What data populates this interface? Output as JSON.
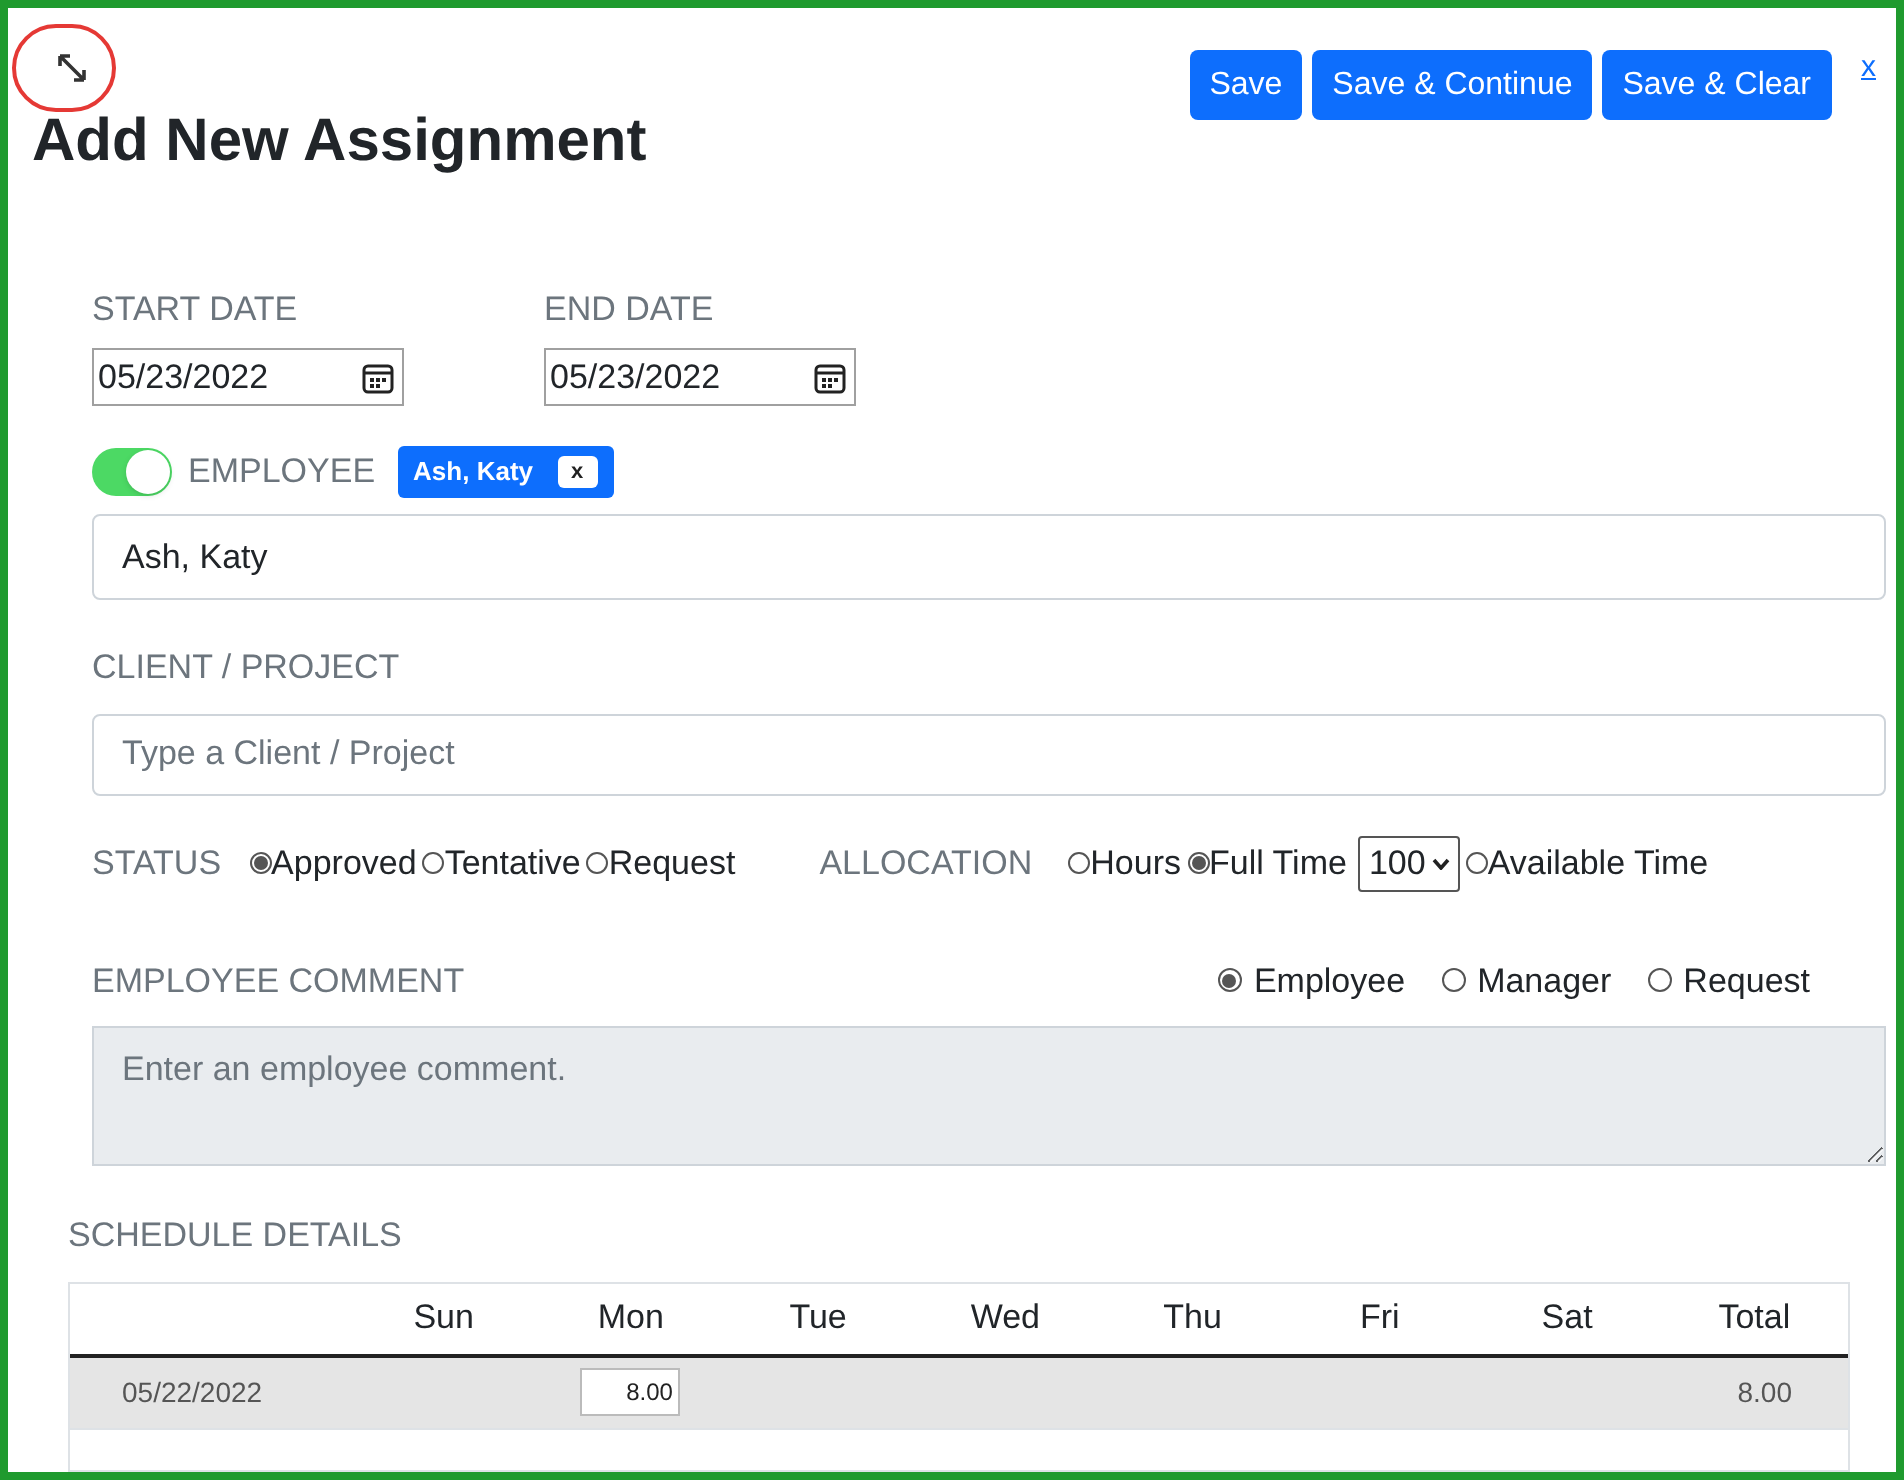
{
  "title": "Add New Assignment",
  "buttons": [
    {
      "label": "Save"
    },
    {
      "label": "Save & Continue"
    },
    {
      "label": "Save & Clear"
    }
  ],
  "close_link": "x",
  "start_date": {
    "label": "START DATE",
    "value": "05/23/2022"
  },
  "end_date": {
    "label": "END DATE",
    "value": "05/23/2022"
  },
  "employee": {
    "label": "EMPLOYEE",
    "on": true,
    "tag": "Ash, Katy",
    "tag_remove": "x",
    "value": "Ash, Katy"
  },
  "client_project": {
    "label": "CLIENT / PROJECT",
    "placeholder": "Type a Client / Project"
  },
  "status": {
    "label": "STATUS",
    "options": [
      {
        "label": "Approved",
        "selected": true
      },
      {
        "label": "Tentative",
        "selected": false
      },
      {
        "label": "Request",
        "selected": false
      }
    ]
  },
  "allocation": {
    "label": "ALLOCATION",
    "options": [
      {
        "kind": "radio",
        "label": "Hours",
        "selected": false
      },
      {
        "kind": "radio",
        "label": "Full Time",
        "selected": true
      },
      {
        "kind": "select",
        "value": "100"
      },
      {
        "kind": "radio",
        "label": "Available Time",
        "selected": false
      }
    ]
  },
  "comment": {
    "label": "EMPLOYEE COMMENT",
    "options": [
      {
        "label": "Employee",
        "selected": true
      },
      {
        "label": "Manager",
        "selected": false
      },
      {
        "label": "Request",
        "selected": false
      }
    ],
    "placeholder": "Enter an employee comment."
  },
  "schedule": {
    "label": "SCHEDULE DETAILS",
    "columns": [
      "Sun",
      "Mon",
      "Tue",
      "Wed",
      "Thu",
      "Fri",
      "Sat",
      "Total"
    ],
    "rows": [
      {
        "date": "05/22/2022",
        "cells": [
          {
            "kind": "empty"
          },
          {
            "kind": "input",
            "value": "8.00"
          },
          {
            "kind": "empty"
          },
          {
            "kind": "empty"
          },
          {
            "kind": "empty"
          },
          {
            "kind": "empty"
          },
          {
            "kind": "empty"
          }
        ],
        "total": "8.00"
      }
    ]
  }
}
